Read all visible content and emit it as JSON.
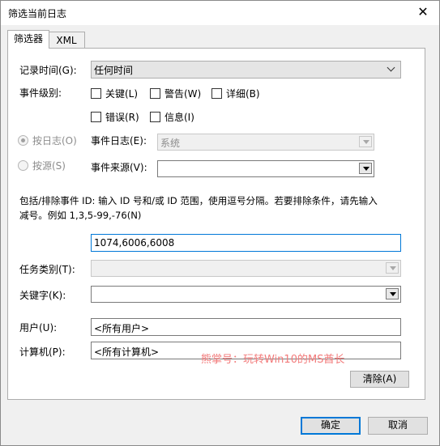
{
  "window": {
    "title": "筛选当前日志",
    "close_glyph": "✕"
  },
  "tabs": [
    {
      "label": "筛选器",
      "active": true
    },
    {
      "label": "XML",
      "active": false
    }
  ],
  "filter": {
    "logged_label": "记录时间(G):",
    "logged_value": "任何时间",
    "event_level_label": "事件级别:",
    "levels": [
      {
        "label": "关键(L)",
        "checked": false
      },
      {
        "label": "警告(W)",
        "checked": false
      },
      {
        "label": "详细(B)",
        "checked": false
      },
      {
        "label": "错误(R)",
        "checked": false
      },
      {
        "label": "信息(I)",
        "checked": false
      }
    ],
    "by_log_label": "按日志(O)",
    "by_source_label": "按源(S)",
    "event_logs_label": "事件日志(E):",
    "event_logs_value": "系统",
    "event_sources_label": "事件来源(V):",
    "event_sources_value": "",
    "event_id_hint_line1": "包括/排除事件 ID: 输入 ID 号和/或 ID 范围，使用逗号分隔。若要排除条件，请先输入",
    "event_id_hint_line2": "减号。例如 1,3,5-99,-76(N)",
    "event_id_value": "1074,6006,6008",
    "task_category_label": "任务类别(T):",
    "task_category_value": "",
    "keywords_label": "关键字(K):",
    "keywords_value": "",
    "user_label": "用户(U):",
    "user_value": "<所有用户>",
    "computer_label": "计算机(P):",
    "computer_value": "<所有计算机>",
    "clear_label": "清除(A)"
  },
  "watermark": "熊掌号：玩转Win10的MS酋长",
  "footer": {
    "ok_label": "确定",
    "cancel_label": "取消"
  }
}
